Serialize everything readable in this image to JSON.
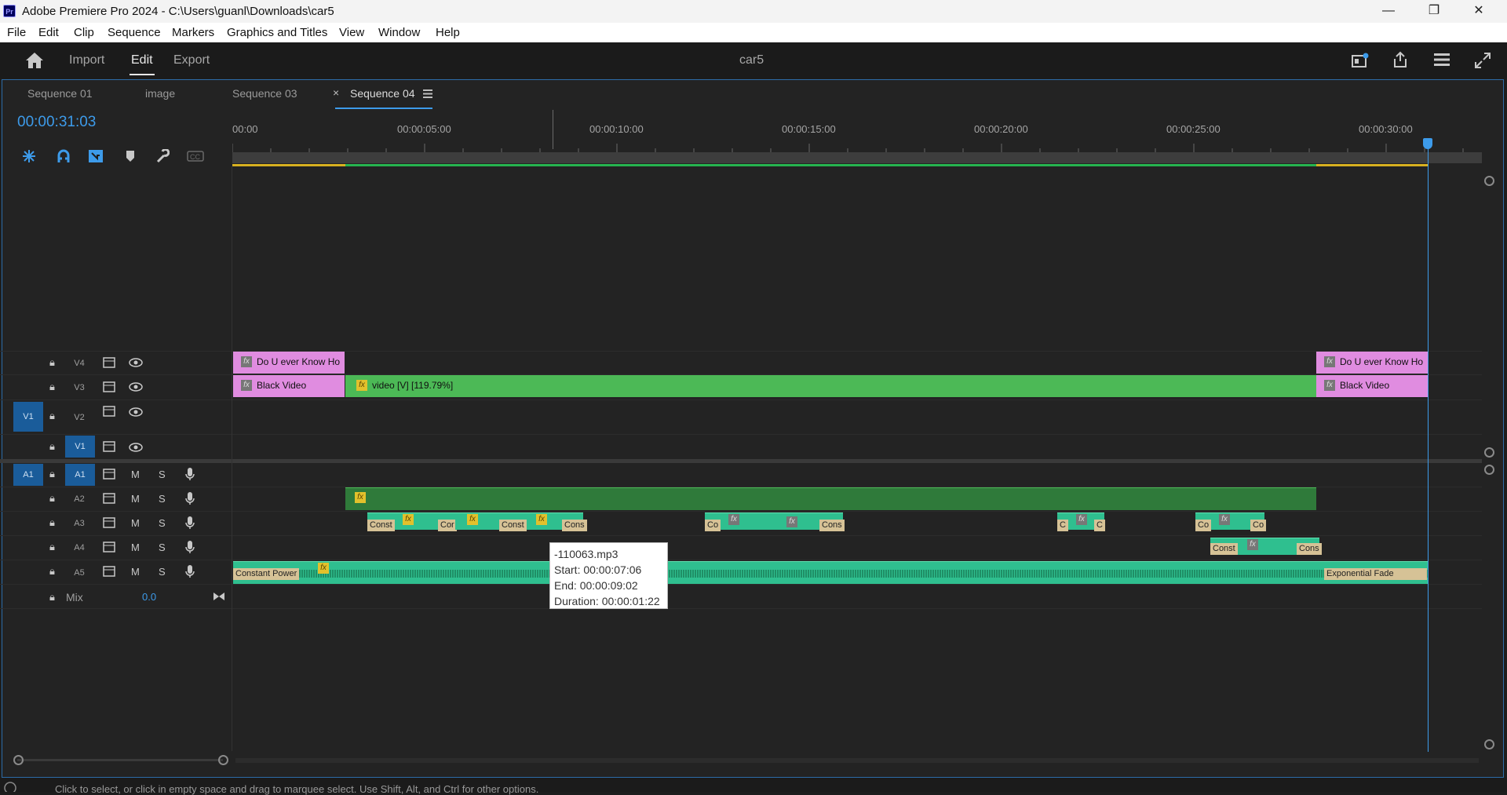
{
  "titlebar": {
    "app_icon": "Pr",
    "title": "Adobe Premiere Pro 2024 - C:\\Users\\guanl\\Downloads\\car5",
    "minimize": "—",
    "restore": "❐",
    "close": "✕"
  },
  "menu": [
    "File",
    "Edit",
    "Clip",
    "Sequence",
    "Markers",
    "Graphics and Titles",
    "View",
    "Window",
    "Help"
  ],
  "workspace": {
    "import": "Import",
    "edit": "Edit",
    "export": "Export",
    "project": "car5"
  },
  "tabs": {
    "seq01": "Sequence 01",
    "image": "image",
    "seq03": "Sequence 03",
    "close": "×",
    "seq04": "Sequence 04"
  },
  "timecode": "00:00:31:03",
  "ruler": [
    "00:00",
    "00:00:05:00",
    "00:00:10:00",
    "00:00:15:00",
    "00:00:20:00",
    "00:00:25:00",
    "00:00:30:00"
  ],
  "video_tracks": {
    "v4": {
      "name": "V4"
    },
    "v3": {
      "name": "V3"
    },
    "v2": {
      "name": "V2",
      "source_patch": "V1"
    },
    "v1": {
      "name": "V1"
    }
  },
  "audio_tracks": {
    "a1": {
      "name": "A1",
      "source_patch": "A1"
    },
    "a2": {
      "name": "A2"
    },
    "a3": {
      "name": "A3"
    },
    "a4": {
      "name": "A4"
    },
    "a5": {
      "name": "A5"
    },
    "mute": "M",
    "solo": "S"
  },
  "mix": {
    "label": "Mix",
    "value": "0.0"
  },
  "clips": {
    "fx": "fx",
    "v4_left": "Do U ever Know Ho",
    "v4_right": "Do U ever Know Ho",
    "v3_left": "Black Video",
    "v3_main": "video [V] [119.79%]",
    "v3_right": "Black Video",
    "a3_t1": "Const",
    "a3_t2": "Cor",
    "a3_t3": "Const",
    "a3_t4": "Cons",
    "a3_t5": "Co",
    "a3_t6": "Cons",
    "a3_t7": "C",
    "a3_t8": "C",
    "a3_t9": "Co",
    "a3_t10": "Co",
    "a4_t1": "Const",
    "a4_t2": "Cons",
    "a5_t1": "Constant Power",
    "a5_t2": "Exponential Fade"
  },
  "tooltip": {
    "file": "-110063.mp3",
    "start": "Start: 00:00:07:06",
    "end": "End: 00:00:09:02",
    "duration": "Duration: 00:00:01:22"
  },
  "status": "Click to select, or click in empty space and drag to marquee select. Use Shift, Alt, and Ctrl for other options.",
  "colors": {
    "accent": "#3d9bea",
    "video_clip": "#4cb956",
    "title_clip": "#e08ce0",
    "audio_clip": "#2fbf8f"
  }
}
